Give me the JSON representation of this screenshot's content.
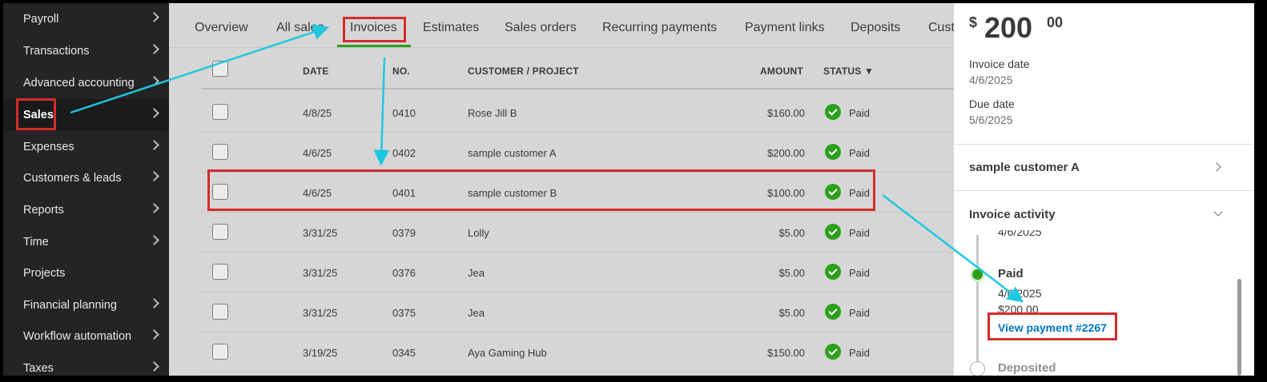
{
  "sidebar": {
    "items": [
      {
        "label": "Payroll"
      },
      {
        "label": "Transactions"
      },
      {
        "label": "Advanced accounting"
      },
      {
        "label": "Sales"
      },
      {
        "label": "Expenses"
      },
      {
        "label": "Customers & leads"
      },
      {
        "label": "Reports"
      },
      {
        "label": "Time"
      },
      {
        "label": "Projects"
      },
      {
        "label": "Financial planning"
      },
      {
        "label": "Workflow automation"
      },
      {
        "label": "Taxes"
      }
    ],
    "active_item": "Sales"
  },
  "tabs": [
    "Overview",
    "All sales",
    "Invoices",
    "Estimates",
    "Sales orders",
    "Recurring payments",
    "Payment links",
    "Deposits",
    "Cust"
  ],
  "active_tab": "Invoices",
  "table": {
    "columns": {
      "date": "DATE",
      "no": "NO.",
      "customer": "CUSTOMER / PROJECT",
      "amount": "AMOUNT",
      "status": "STATUS ▼"
    },
    "rows": [
      {
        "date": "4/8/25",
        "no": "0410",
        "customer": "Rose Jill B",
        "amount": "$160.00",
        "status": "Paid"
      },
      {
        "date": "4/6/25",
        "no": "0402",
        "customer": "sample customer A",
        "amount": "$200.00",
        "status": "Paid"
      },
      {
        "date": "4/6/25",
        "no": "0401",
        "customer": "sample customer B",
        "amount": "$100.00",
        "status": "Paid"
      },
      {
        "date": "3/31/25",
        "no": "0379",
        "customer": "Lolly",
        "amount": "$5.00",
        "status": "Paid"
      },
      {
        "date": "3/31/25",
        "no": "0376",
        "customer": "Jea",
        "amount": "$5.00",
        "status": "Paid"
      },
      {
        "date": "3/31/25",
        "no": "0375",
        "customer": "Jea",
        "amount": "$5.00",
        "status": "Paid"
      },
      {
        "date": "3/19/25",
        "no": "0345",
        "customer": "Aya Gaming Hub",
        "amount": "$150.00",
        "status": "Paid"
      }
    ]
  },
  "panel": {
    "currency": "$",
    "amount_whole": "200",
    "amount_cents": "00",
    "invoice_date_label": "Invoice date",
    "invoice_date": "4/6/2025",
    "due_date_label": "Due date",
    "due_date": "5/6/2025",
    "customer": "sample customer A",
    "activity_label": "Invoice activity",
    "timeline_partial_date": "4/6/2025",
    "paid_label": "Paid",
    "paid_date": "4/6/2025",
    "paid_amount": "$200.00",
    "view_payment": "View payment #2267",
    "deposited_label": "Deposited"
  },
  "colors": {
    "sidebar_bg": "#242424",
    "accent_green": "#2ca01c",
    "link_blue": "#0077c5",
    "annotation_red": "#d52b2b",
    "annotation_arrow": "#1ec8e0"
  }
}
